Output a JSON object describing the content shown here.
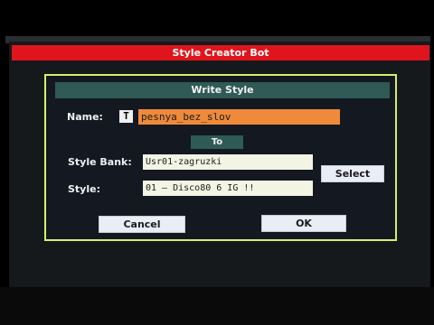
{
  "window": {
    "title": "Style Creator Bot"
  },
  "dialog": {
    "title": "Write Style",
    "name_label": "Name:",
    "text_icon_glyph": "T",
    "name_value": "pesnya_bez_slov",
    "to_label": "To",
    "style_bank_label": "Style Bank:",
    "style_bank_value": "Usr01-zagruzki",
    "select_label": "Select",
    "style_label": "Style:",
    "style_value": "01 — Disco80 6 IG !!",
    "cancel_label": "Cancel",
    "ok_label": "OK"
  },
  "colors": {
    "title_bar": "#e0141c",
    "dialog_border": "#d4f06a",
    "header_teal": "#2f5a56",
    "name_field": "#ee8a3a",
    "field_bg": "#f2f4e4",
    "button_bg": "#e8edf6"
  }
}
